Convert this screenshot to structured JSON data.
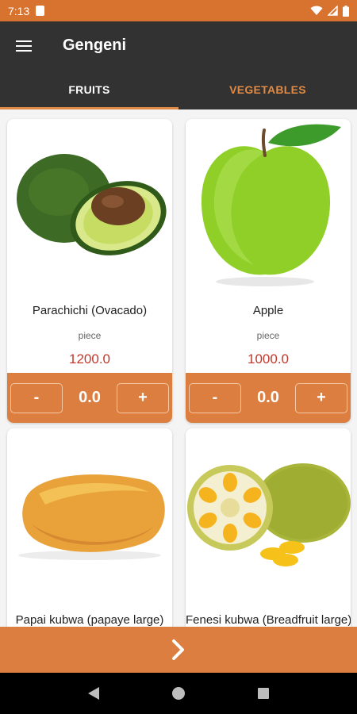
{
  "status": {
    "time": "7:13"
  },
  "app": {
    "title": "Gengeni"
  },
  "tabs": [
    {
      "label": "FRUITS",
      "active": true
    },
    {
      "label": "VEGETABLES",
      "active": false
    }
  ],
  "products": [
    {
      "name": "Parachichi (Ovacado)",
      "unit": "piece",
      "price": "1200.0",
      "quantity": "0.0",
      "minus": "-",
      "plus": "+"
    },
    {
      "name": "Apple",
      "unit": "piece",
      "price": "1000.0",
      "quantity": "0.0",
      "minus": "-",
      "plus": "+"
    },
    {
      "name": "Papai kubwa (papaye large)",
      "unit": "",
      "price": "",
      "quantity": ""
    },
    {
      "name": "Fenesi kubwa (Breadfruit large)",
      "unit": "",
      "price": "",
      "quantity": ""
    }
  ],
  "colors": {
    "accent": "#db7e3f",
    "appbar": "#323232",
    "price": "#c0392b",
    "tab_inactive": "#e08a45"
  },
  "icons": {
    "menu": "hamburger-menu-icon",
    "next": "chevron-right-icon"
  }
}
